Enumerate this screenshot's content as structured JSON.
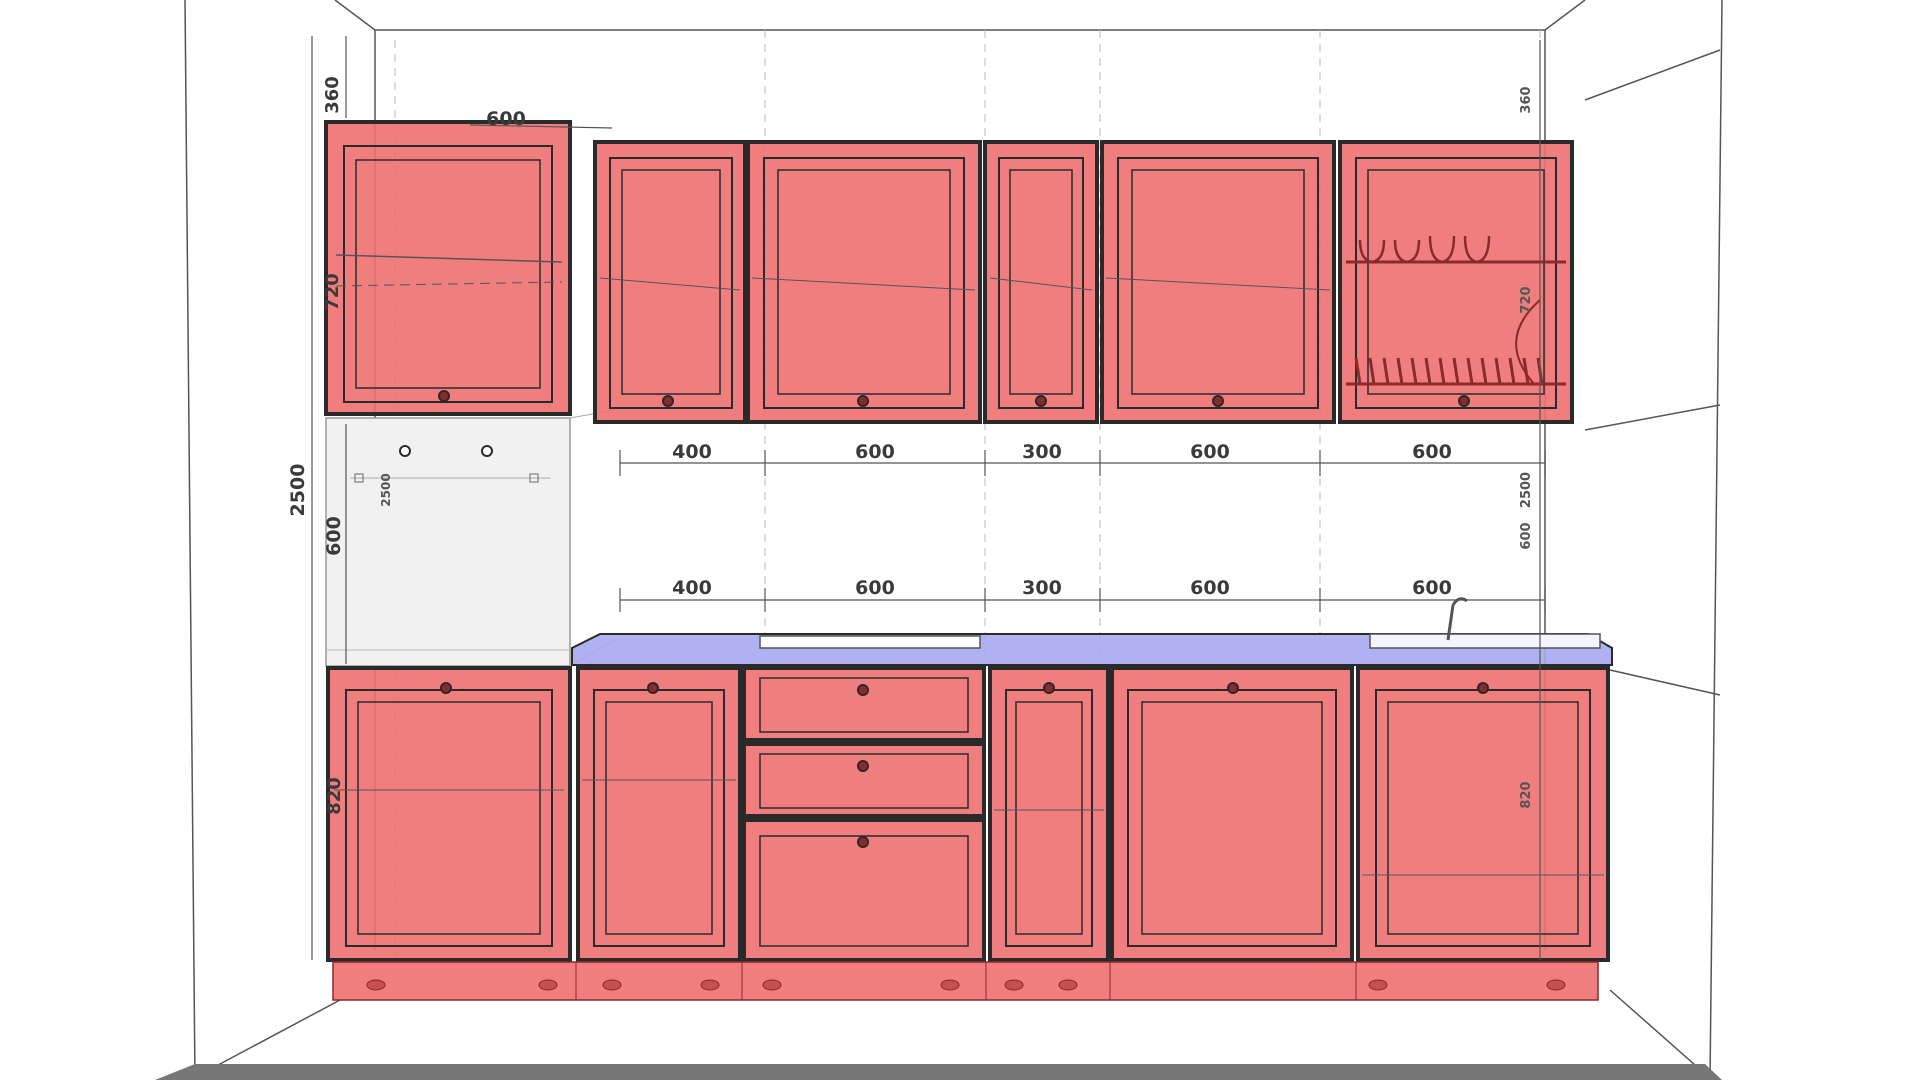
{
  "colors": {
    "cabinet_fill": "#ef7070",
    "cabinet_stroke": "#2a2a2a",
    "countertop": "#a8a8f0",
    "oven_niche": "#f1f1f1",
    "wall_line": "#555555",
    "floor": "#777777"
  },
  "dimensions": {
    "total_height": "2500",
    "top_gap": "360",
    "upper_height": "720",
    "niche_height": "600",
    "base_height": "820",
    "column_width": "600",
    "column_inner_height": "2500",
    "right_top": "360",
    "right_upper": "720",
    "right_total": "2500",
    "right_niche": "600",
    "right_base": "820"
  },
  "upper_widths": [
    "400",
    "600",
    "300",
    "600",
    "600"
  ],
  "lower_widths": [
    "400",
    "600",
    "300",
    "600",
    "600"
  ],
  "upper_cabinets": [
    {
      "id": "upper-400",
      "width_mm": 400
    },
    {
      "id": "upper-600",
      "width_mm": 600
    },
    {
      "id": "upper-300",
      "width_mm": 300
    },
    {
      "id": "upper-600b",
      "width_mm": 600
    },
    {
      "id": "upper-600-dish-rack",
      "width_mm": 600
    }
  ],
  "base_cabinets": [
    {
      "id": "base-400",
      "width_mm": 400
    },
    {
      "id": "base-600-drawers",
      "width_mm": 600,
      "drawers": 3
    },
    {
      "id": "base-300",
      "width_mm": 300
    },
    {
      "id": "base-600",
      "width_mm": 600
    },
    {
      "id": "base-600-sink",
      "width_mm": 600
    }
  ]
}
